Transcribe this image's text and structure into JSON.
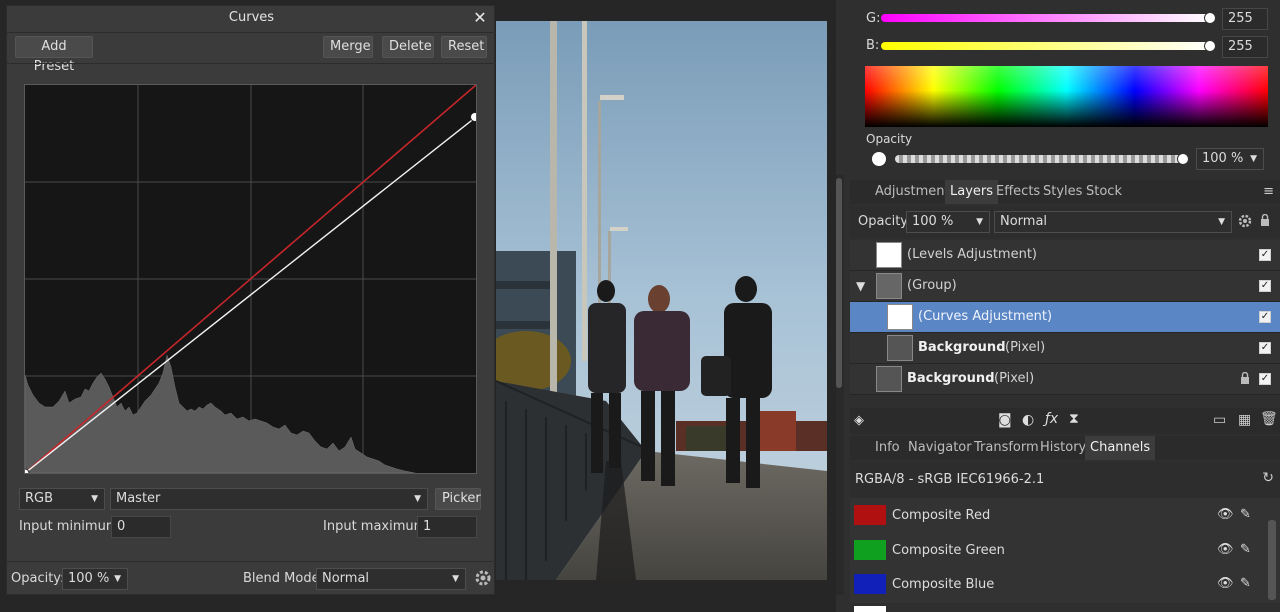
{
  "curves": {
    "title": "Curves",
    "add_preset": "Add Preset",
    "merge": "Merge",
    "delete": "Delete",
    "reset": "Reset",
    "channel_select": "RGB",
    "master_select": "Master",
    "picker": "Picker",
    "input_min_label": "Input minimum:",
    "input_min_value": "0",
    "input_max_label": "Input maximum:",
    "input_max_value": "1",
    "opacity_label": "Opacity:",
    "opacity_value": "100 %",
    "blend_label": "Blend Mode:",
    "blend_value": "Normal"
  },
  "color": {
    "g_label": "G:",
    "g_value": "255",
    "b_label": "B:",
    "b_value": "255",
    "opacity_label": "Opacity",
    "opacity_value": "100 %"
  },
  "layers_tabs": [
    "Adjustment",
    "Layers",
    "Effects",
    "Styles",
    "Stock"
  ],
  "layers_bar": {
    "opacity_label": "Opacity:",
    "opacity_value": "100 %",
    "blend_value": "Normal"
  },
  "layers": [
    {
      "name": "(Levels Adjustment)",
      "suffix": ""
    },
    {
      "name": "(Group)",
      "suffix": ""
    },
    {
      "name": "(Curves Adjustment)",
      "suffix": ""
    },
    {
      "name": "Background",
      "suffix": "(Pixel)"
    },
    {
      "name": "Background",
      "suffix": "(Pixel)"
    }
  ],
  "bottom_tabs": [
    "Info",
    "Navigator",
    "Transform",
    "History",
    "Channels"
  ],
  "channels_header": "RGBA/8 - sRGB IEC61966-2.1",
  "channels": [
    {
      "name": "Composite Red",
      "color": "#cc1111"
    },
    {
      "name": "Composite Green",
      "color": "#11bb22"
    },
    {
      "name": "Composite Blue",
      "color": "#1122cc"
    }
  ],
  "icons": {
    "close": "close-icon",
    "gear": "gear-icon",
    "lock": "lock-icon",
    "eye": "eye-icon",
    "pencil": "pencil-icon"
  }
}
